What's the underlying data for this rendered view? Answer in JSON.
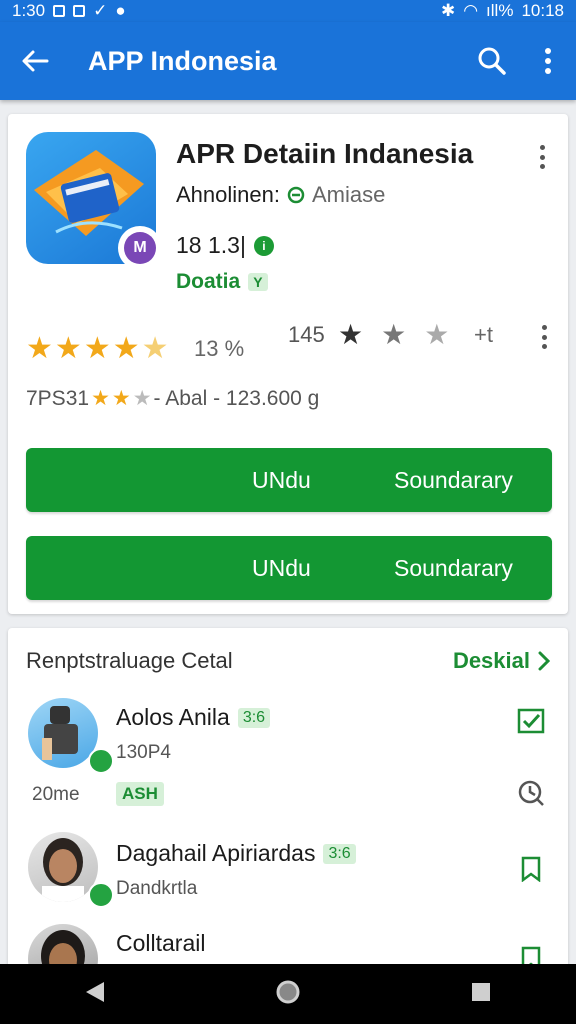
{
  "status": {
    "time_left": "1:30",
    "time_right": "10:18",
    "battery": "ıll%"
  },
  "appbar": {
    "title": "APP Indonesia"
  },
  "app": {
    "name": "APR Detaiin Indanesia",
    "developer_label": "Ahnolinen:",
    "developer_value": "Amiase",
    "size": "18 1.3|",
    "category": "Doatia",
    "category_chip": "Y",
    "icon_badge": "M"
  },
  "rating": {
    "percent": "13 %",
    "count": "145",
    "plus": "+t",
    "stars_filled": 4.5
  },
  "meta": {
    "prefix": "7PS31",
    "suffix": "- Abal - 123.600 g"
  },
  "buttons": [
    {
      "left": "UNdu",
      "right": "Soundarary"
    },
    {
      "left": "UNdu",
      "right": "Soundarary"
    }
  ],
  "section": {
    "title": "Renptstraluage Cetal",
    "link": "Deskial"
  },
  "people": [
    {
      "name": "Aolos Anila",
      "chip": "3:6",
      "sub": "130P4",
      "left": "20me",
      "tag": "ASH"
    },
    {
      "name": "Dagahail Apiriardas",
      "chip": "3:6",
      "sub": "Dandkrtla"
    },
    {
      "name": "Colltarail"
    }
  ],
  "colors": {
    "accent": "#1a73d9",
    "primary_button": "#139733",
    "link": "#1c8d34"
  }
}
